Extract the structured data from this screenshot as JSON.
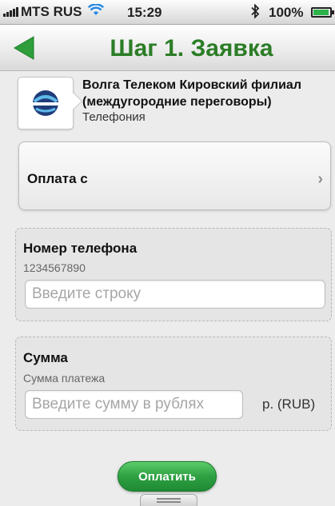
{
  "status_bar": {
    "carrier": "MTS RUS",
    "time": "15:29",
    "battery": "100%",
    "battery_level": 1.0,
    "icons": [
      "signal-icon",
      "wifi-icon",
      "bluetooth-icon",
      "battery-icon"
    ]
  },
  "nav": {
    "title": "Шаг 1. Заявка",
    "back_icon": "back-arrow-icon",
    "accent_color": "#2b7d26"
  },
  "provider": {
    "name": "Волга Телеком Кировский филиал (междугородние переговоры)",
    "category": "Телефония"
  },
  "pay_from": {
    "label": "Оплата с",
    "chevron": "›"
  },
  "phone_field": {
    "title": "Номер телефона",
    "hint": "1234567890",
    "placeholder": "Введите строку",
    "value": ""
  },
  "amount_field": {
    "title": "Сумма",
    "hint": "Сумма платежа",
    "placeholder": "Введите сумму в рублях",
    "value": "",
    "currency": "р. (RUB)"
  },
  "pay_button": {
    "label": "Оплатить",
    "color": "#2ea043"
  }
}
